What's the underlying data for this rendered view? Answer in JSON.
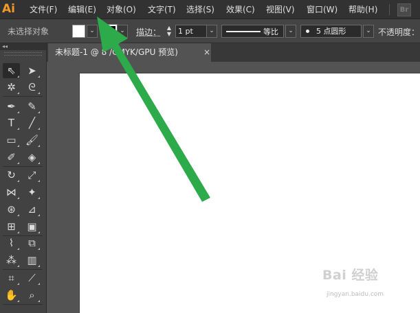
{
  "app": {
    "logo_text": "Ai",
    "bridge_icon": "Br"
  },
  "menubar": {
    "items": [
      {
        "label": "文件(F)"
      },
      {
        "label": "编辑(E)"
      },
      {
        "label": "对象(O)"
      },
      {
        "label": "文字(T)"
      },
      {
        "label": "选择(S)"
      },
      {
        "label": "效果(C)"
      },
      {
        "label": "视图(V)"
      },
      {
        "label": "窗口(W)"
      },
      {
        "label": "帮助(H)"
      }
    ]
  },
  "controlbar": {
    "selection_status": "未选择对象",
    "fill_color": "#ffffff",
    "stroke_color": "#000000",
    "stroke_label": "描边：",
    "stroke_weight": "1 pt",
    "stroke_profile_label": "等比",
    "brush_definition": "5 点圆形",
    "opacity_label": "不透明度："
  },
  "tools": {
    "collapse_glyph": "◂◂",
    "items": [
      {
        "name": "selection-tool-icon",
        "glyph": "⇖",
        "active": true
      },
      {
        "name": "direct-selection-tool-icon",
        "glyph": "➤"
      },
      {
        "name": "magic-wand-tool-icon",
        "glyph": "✲"
      },
      {
        "name": "lasso-tool-icon",
        "glyph": "ᘓ"
      },
      {
        "name": "pen-tool-icon",
        "glyph": "✒"
      },
      {
        "name": "curvature-tool-icon",
        "glyph": "✎"
      },
      {
        "name": "type-tool-icon",
        "glyph": "T"
      },
      {
        "name": "line-segment-tool-icon",
        "glyph": "╱"
      },
      {
        "name": "rectangle-tool-icon",
        "glyph": "▭"
      },
      {
        "name": "paintbrush-tool-icon",
        "glyph": "🖌"
      },
      {
        "name": "shaper-tool-icon",
        "glyph": "✐"
      },
      {
        "name": "eraser-tool-icon",
        "glyph": "◈"
      },
      {
        "name": "rotate-tool-icon",
        "glyph": "↻"
      },
      {
        "name": "scale-tool-icon",
        "glyph": "⤢"
      },
      {
        "name": "width-tool-icon",
        "glyph": "⋈"
      },
      {
        "name": "puppet-warp-tool-icon",
        "glyph": "✦"
      },
      {
        "name": "shape-builder-tool-icon",
        "glyph": "⊛"
      },
      {
        "name": "perspective-grid-tool-icon",
        "glyph": "⊿"
      },
      {
        "name": "mesh-tool-icon",
        "glyph": "⊞"
      },
      {
        "name": "gradient-tool-icon",
        "glyph": "▣"
      },
      {
        "name": "eyedropper-tool-icon",
        "glyph": "⌇"
      },
      {
        "name": "blend-tool-icon",
        "glyph": "⧉"
      },
      {
        "name": "symbol-sprayer-tool-icon",
        "glyph": "⁂"
      },
      {
        "name": "column-graph-tool-icon",
        "glyph": "▥"
      },
      {
        "name": "artboard-tool-icon",
        "glyph": "⌗"
      },
      {
        "name": "slice-tool-icon",
        "glyph": "⟋"
      },
      {
        "name": "hand-tool-icon",
        "glyph": "✋"
      },
      {
        "name": "zoom-tool-icon",
        "glyph": "⌕"
      }
    ]
  },
  "document": {
    "tab_title": "未标题-1 @ 8   /CMYK/GPU 预览)",
    "close_glyph": "×"
  },
  "watermark": {
    "brand": "Bai 经验",
    "url": "jingyan.baidu.com"
  },
  "annotation": {
    "arrow_color": "#2daa4a"
  }
}
